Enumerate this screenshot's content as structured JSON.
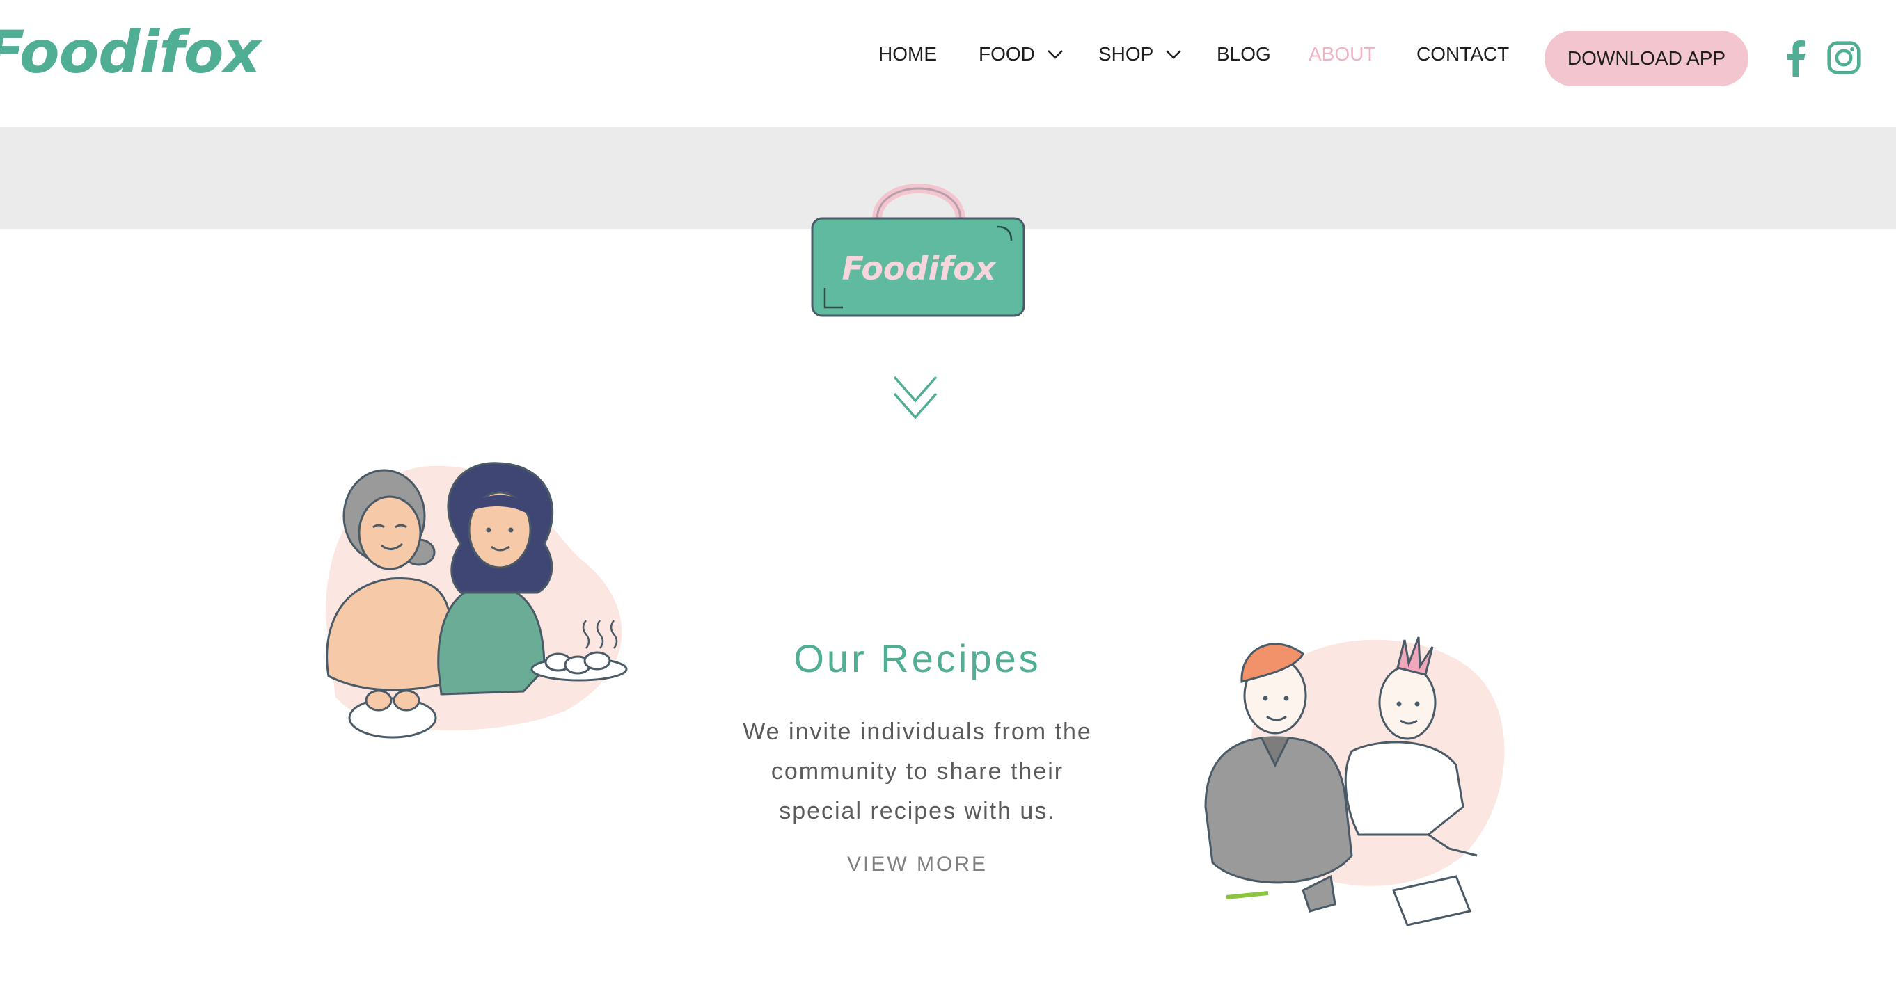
{
  "brand": {
    "logo_text": "Foodifox",
    "bag_text": "Foodifox"
  },
  "nav": {
    "items": [
      {
        "label": "HOME",
        "has_dropdown": false,
        "active": false
      },
      {
        "label": "FOOD",
        "has_dropdown": true,
        "active": false
      },
      {
        "label": "SHOP",
        "has_dropdown": true,
        "active": false
      },
      {
        "label": "BLOG",
        "has_dropdown": false,
        "active": false
      },
      {
        "label": "ABOUT",
        "has_dropdown": false,
        "active": true
      },
      {
        "label": "CONTACT",
        "has_dropdown": false,
        "active": false
      }
    ],
    "cta_label": "DOWNLOAD APP",
    "social": [
      "facebook-icon",
      "instagram-icon"
    ]
  },
  "section": {
    "title": "Our Recipes",
    "body_lines": [
      "We invite individuals from the",
      "community to share their",
      "special recipes with us."
    ],
    "link_label": "VIEW MORE"
  },
  "colors": {
    "brand_green": "#4fae93",
    "pink": "#f3c5cf",
    "active_nav": "#f1b3c1",
    "band_grey": "#ebebeb",
    "blob": "#fbe6e1"
  }
}
